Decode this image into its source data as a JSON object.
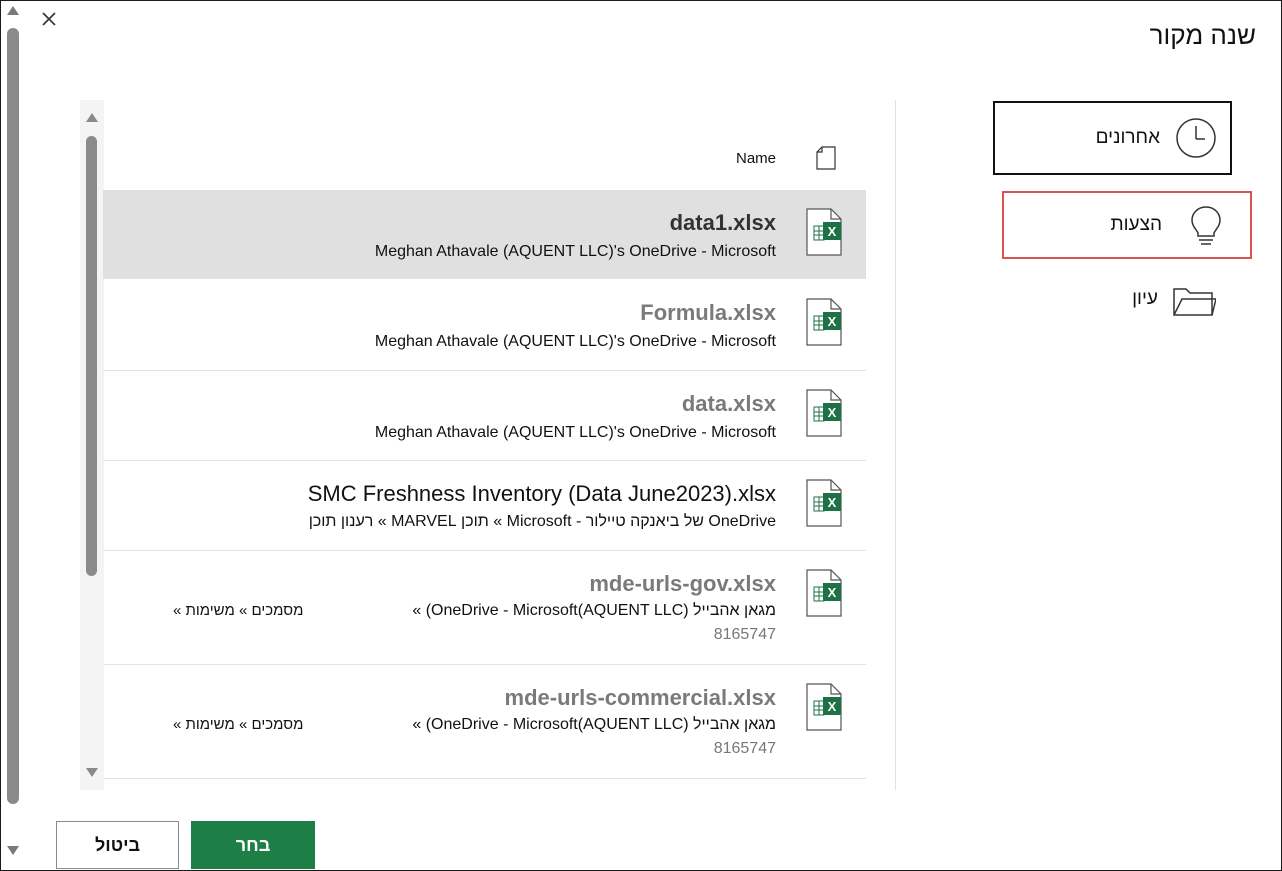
{
  "dialog": {
    "title": "שנה מקור",
    "close_label": "×"
  },
  "nav": {
    "items": [
      {
        "label": "אחרונים",
        "icon": "clock-icon",
        "state": "focused"
      },
      {
        "label": "הצעות",
        "icon": "lightbulb-icon",
        "state": "highlighted"
      },
      {
        "label": "עיון",
        "icon": "folder-icon",
        "state": "normal"
      }
    ]
  },
  "list": {
    "column_header": "Name",
    "files": [
      {
        "name": "data1.xlsx",
        "location": "Meghan Athavale (AQUENT LLC)'s OneDrive - Microsoft",
        "selected": true
      },
      {
        "name": "Formula.xlsx",
        "location": "Meghan Athavale (AQUENT LLC)'s OneDrive - Microsoft",
        "selected": false
      },
      {
        "name": "data.xlsx",
        "location": "Meghan Athavale (AQUENT LLC)'s OneDrive - Microsoft",
        "selected": false
      },
      {
        "name": "SMC Freshness Inventory (Data June2023).xlsx",
        "location": "OneDrive של ביאנקה טיילור - Microsoft » תוכן MARVEL » רענון תוכן",
        "selected": false
      },
      {
        "name": "mde-urls-gov.xlsx",
        "location": "מגאן אהבייל (AQUENT LLC)OneDrive - Microsoft) »",
        "crumb": "מסמכים » משימות »",
        "extra": "8165747",
        "selected": false
      },
      {
        "name": "mde-urls-commercial.xlsx",
        "location": "מגאן אהבייל (AQUENT LLC)OneDrive - Microsoft) »",
        "crumb": "מסמכים » משימות »",
        "extra": "8165747",
        "selected": false
      }
    ]
  },
  "footer": {
    "select_label": "בחר",
    "cancel_label": "ביטול"
  },
  "colors": {
    "accent_green": "#1e7f46",
    "excel_green": "#1e7145",
    "highlight_red": "#d9534f",
    "selected_row": "#e0e0e0"
  }
}
